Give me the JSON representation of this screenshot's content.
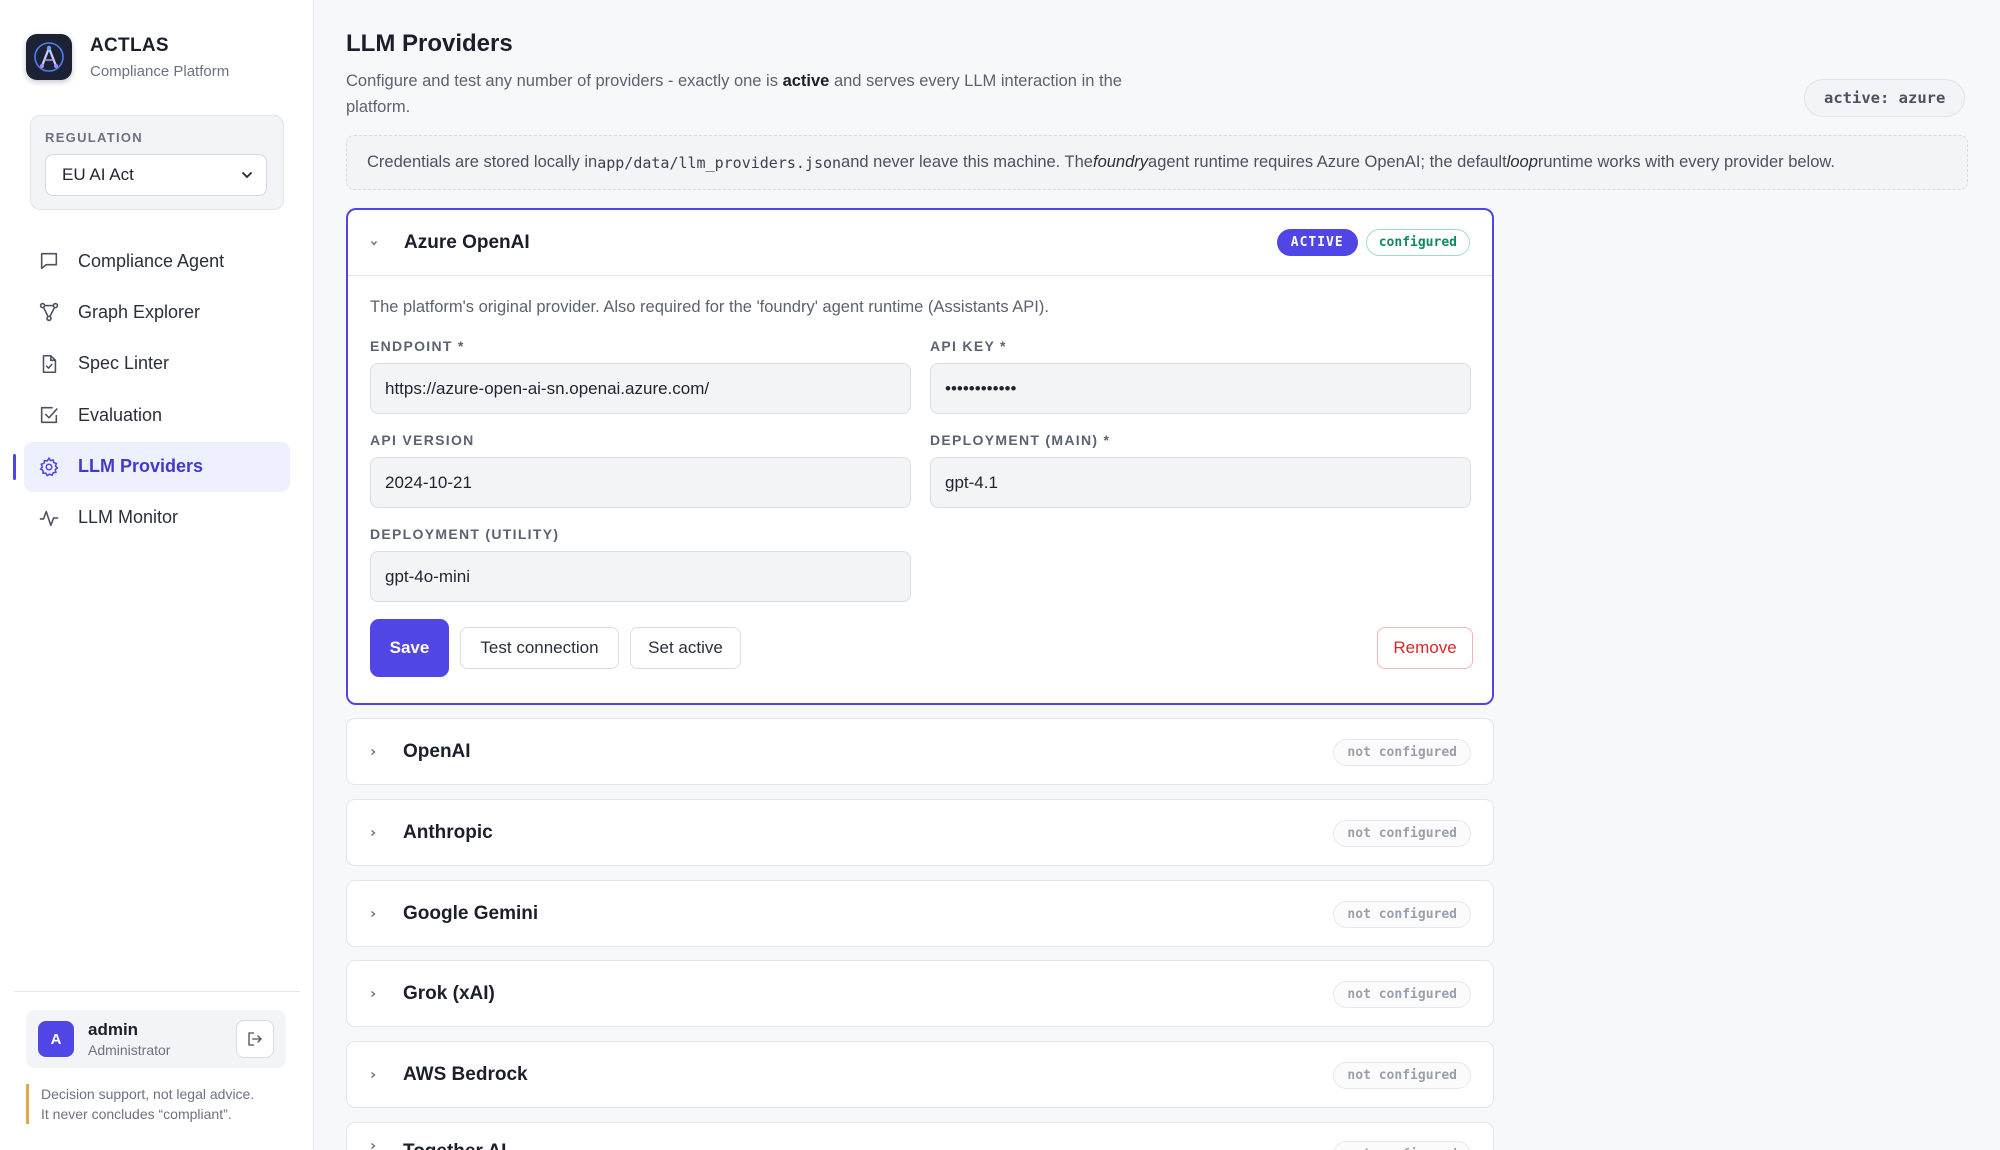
{
  "brand": {
    "name": "ACTLAS",
    "subtitle": "Compliance Platform"
  },
  "regulation": {
    "label": "REGULATION",
    "selected": "EU AI Act"
  },
  "nav": [
    {
      "label": "Compliance Agent",
      "icon": "chat-icon",
      "active": false
    },
    {
      "label": "Graph Explorer",
      "icon": "graph-icon",
      "active": false
    },
    {
      "label": "Spec Linter",
      "icon": "file-check-icon",
      "active": false
    },
    {
      "label": "Evaluation",
      "icon": "checkbox-icon",
      "active": false
    },
    {
      "label": "LLM Providers",
      "icon": "gear-icon",
      "active": true
    },
    {
      "label": "LLM Monitor",
      "icon": "pulse-icon",
      "active": false
    }
  ],
  "user": {
    "initial": "A",
    "name": "admin",
    "role": "Administrator"
  },
  "disclaimer": {
    "line1": "Decision support, not legal advice.",
    "line2": "It never concludes “compliant”."
  },
  "page": {
    "title": "LLM Providers",
    "desc_before": "Configure and test any number of providers - exactly one is ",
    "desc_bold": "active",
    "desc_after": " and serves every LLM interaction in the platform.",
    "active_pill": "active: azure"
  },
  "note": {
    "t1": "Credentials are stored locally in ",
    "path": "app/data/llm_providers.json",
    "t2": " and never leave this machine. The ",
    "foundry": "foundry",
    "t3": " agent runtime requires Azure OpenAI; the default ",
    "loop": "loop",
    "t4": " runtime works with every provider below."
  },
  "azure": {
    "title": "Azure OpenAI",
    "badge_active": "ACTIVE",
    "badge_status": "configured",
    "description": "The platform's original provider. Also required for the 'foundry' agent runtime (Assistants API).",
    "endpoint_label": "ENDPOINT *",
    "endpoint_value": "https://azure-open-ai-sn.openai.azure.com/",
    "apikey_label": "API KEY *",
    "apikey_value": "••••••••••••",
    "apiversion_label": "API VERSION",
    "apiversion_value": "2024-10-21",
    "deploy_main_label": "DEPLOYMENT (MAIN) *",
    "deploy_main_value": "gpt-4.1",
    "deploy_util_label": "DEPLOYMENT (UTILITY)",
    "deploy_util_value": "gpt-4o-mini",
    "save": "Save",
    "test": "Test connection",
    "set_active": "Set active",
    "remove": "Remove"
  },
  "providers": [
    {
      "title": "OpenAI",
      "status": "not configured"
    },
    {
      "title": "Anthropic",
      "status": "not configured"
    },
    {
      "title": "Google Gemini",
      "status": "not configured"
    },
    {
      "title": "Grok (xAI)",
      "status": "not configured"
    },
    {
      "title": "AWS Bedrock",
      "status": "not configured"
    },
    {
      "title": "Together AI",
      "status": "not configured"
    }
  ]
}
